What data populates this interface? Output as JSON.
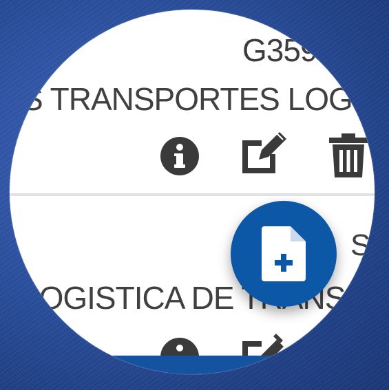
{
  "table": {
    "rows": [
      {
        "code": "G359",
        "company": "S TRANSPORTES LOGIS"
      },
      {
        "status": "S",
        "company": "LOGISTICA DE TRANSPORTES"
      }
    ]
  },
  "actions": {
    "info_icon": "info-icon",
    "edit_icon": "edit-icon",
    "delete_icon": "trash-icon"
  },
  "fab": {
    "icon": "new-document-icon",
    "color": "#0d58a6"
  },
  "colors": {
    "accent": "#0d58a6",
    "text": "#404040",
    "icon": "#3a3a3a",
    "background": "#2a4f9e"
  }
}
